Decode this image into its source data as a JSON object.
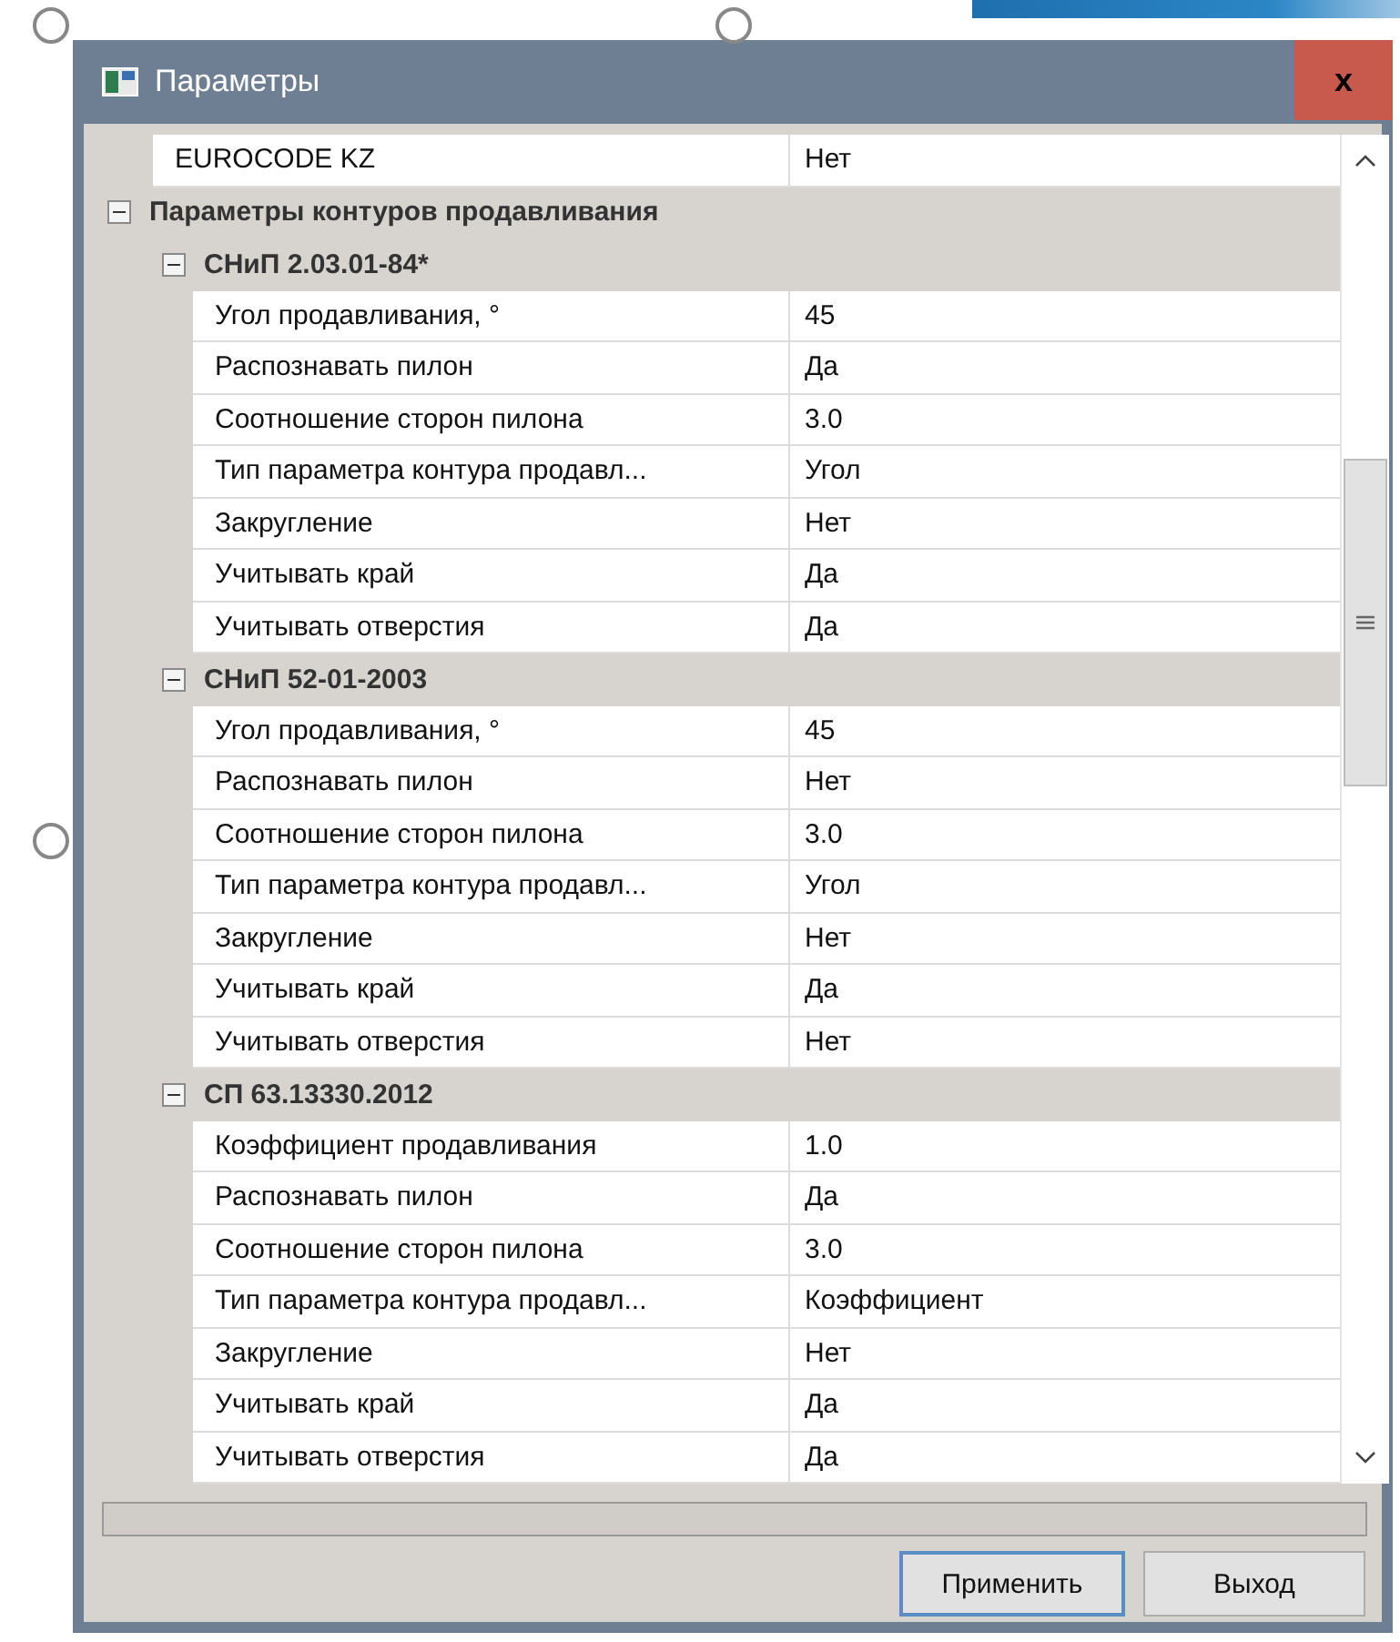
{
  "window": {
    "title": "Параметры",
    "close_button": "x"
  },
  "grid": {
    "rows": [
      {
        "kind": "property",
        "name": "EUROCODE KZ",
        "value": "Нет"
      },
      {
        "kind": "category",
        "label": "Параметры контуров продавливания",
        "expanded": true,
        "children": [
          {
            "kind": "category",
            "label": "СНиП 2.03.01-84*",
            "expanded": true,
            "children": [
              {
                "kind": "property",
                "name": "Угол продавливания, °",
                "value": "45"
              },
              {
                "kind": "property",
                "name": "Распознавать пилон",
                "value": "Да"
              },
              {
                "kind": "property",
                "name": "Соотношение сторон пилона",
                "value": "3.0"
              },
              {
                "kind": "property",
                "name": "Тип параметра контура продавл...",
                "value": "Угол"
              },
              {
                "kind": "property",
                "name": "Закругление",
                "value": "Нет"
              },
              {
                "kind": "property",
                "name": "Учитывать край",
                "value": "Да"
              },
              {
                "kind": "property",
                "name": "Учитывать отверстия",
                "value": "Да"
              }
            ]
          },
          {
            "kind": "category",
            "label": "СНиП 52-01-2003",
            "expanded": true,
            "children": [
              {
                "kind": "property",
                "name": "Угол продавливания, °",
                "value": "45"
              },
              {
                "kind": "property",
                "name": "Распознавать пилон",
                "value": "Нет"
              },
              {
                "kind": "property",
                "name": "Соотношение сторон пилона",
                "value": "3.0"
              },
              {
                "kind": "property",
                "name": "Тип параметра контура продавл...",
                "value": "Угол"
              },
              {
                "kind": "property",
                "name": "Закругление",
                "value": "Нет"
              },
              {
                "kind": "property",
                "name": "Учитывать край",
                "value": "Да"
              },
              {
                "kind": "property",
                "name": "Учитывать отверстия",
                "value": "Нет"
              }
            ]
          },
          {
            "kind": "category",
            "label": "СП 63.13330.2012",
            "expanded": true,
            "children": [
              {
                "kind": "property",
                "name": "Коэффициент продавливания",
                "value": "1.0"
              },
              {
                "kind": "property",
                "name": "Распознавать пилон",
                "value": "Да"
              },
              {
                "kind": "property",
                "name": "Соотношение сторон пилона",
                "value": "3.0"
              },
              {
                "kind": "property",
                "name": "Тип параметра контура продавл...",
                "value": "Коэффициент"
              },
              {
                "kind": "property",
                "name": "Закругление",
                "value": "Нет"
              },
              {
                "kind": "property",
                "name": "Учитывать край",
                "value": "Да"
              },
              {
                "kind": "property",
                "name": "Учитывать отверстия",
                "value": "Да"
              }
            ]
          }
        ]
      }
    ]
  },
  "progress": {
    "level": 0
  },
  "buttons": [
    {
      "label": "Применить",
      "selected": true
    },
    {
      "label": "Выход",
      "selected": false
    }
  ]
}
